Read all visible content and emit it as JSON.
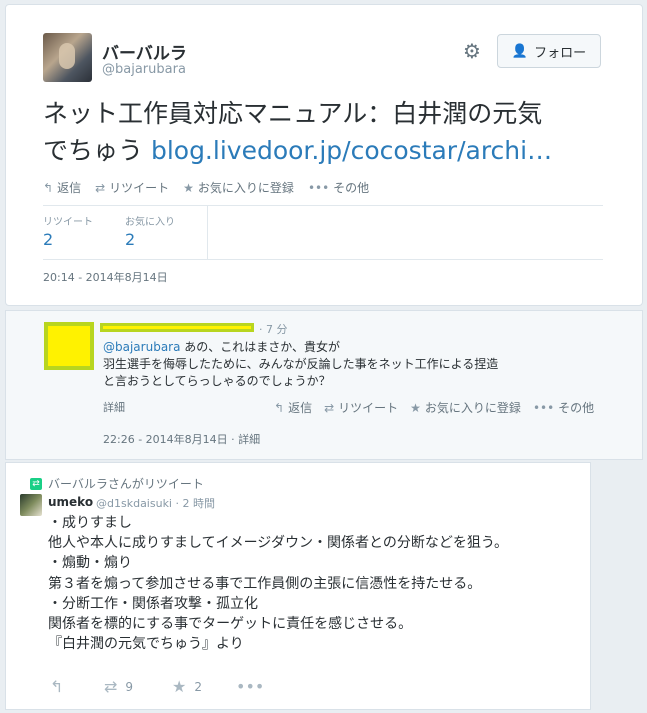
{
  "tweet": {
    "display_name": "バーバルラ",
    "handle": "@bajarubara",
    "follow_label": "フォロー",
    "text_line1": "ネット工作員対応マニュアル：白井潤の元気",
    "text_line2": "でちゅう ",
    "link_text": "blog.livedoor.jp/cocostar/archi…",
    "actions": {
      "reply": "返信",
      "retweet": "リツイート",
      "favorite": "お気に入りに登録",
      "more": "その他"
    },
    "stats": {
      "retweets_label": "リツイート",
      "retweets": "2",
      "favorites_label": "お気に入り",
      "favorites": "2"
    },
    "timestamp": "20:14 - 2014年8月14日"
  },
  "reply": {
    "time": "· 7 分",
    "mention": "@bajarubara",
    "text_line1": " あの、これはまさか、貴女が",
    "text_line2": "羽生選手を侮辱したために、みんなが反論した事をネット工作による捏造",
    "text_line3": "と言おうとしてらっしゃるのでしょうか？",
    "detail": "詳細",
    "actions": {
      "reply": "返信",
      "retweet": "リツイート",
      "favorite": "お気に入りに登録",
      "more": "その他"
    },
    "timestamp": "22:26 - 2014年8月14日 · 詳細"
  },
  "retweeted": {
    "rt_label": "バーバルラさんがリツイート",
    "name": "umeko",
    "handle": "@d1skdaisuki · 2 時間",
    "lines": [
      "・成りすまし",
      "他人や本人に成りすましてイメージダウン・関係者との分断などを狙う。",
      "・煽動・煽り",
      "第３者を煽って参加させる事で工作員側の主張に信憑性を持たせる。",
      "・分断工作・関係者攻撃・孤立化",
      "関係者を標的にする事でターゲットに責任を感じさせる。",
      "『白井潤の元気でちゅう』より"
    ],
    "retweet_count": "9",
    "favorite_count": "2"
  },
  "icons": [
    "gear-icon",
    "add-person-icon",
    "reply-icon",
    "retweet-icon",
    "star-icon",
    "more-icon"
  ]
}
